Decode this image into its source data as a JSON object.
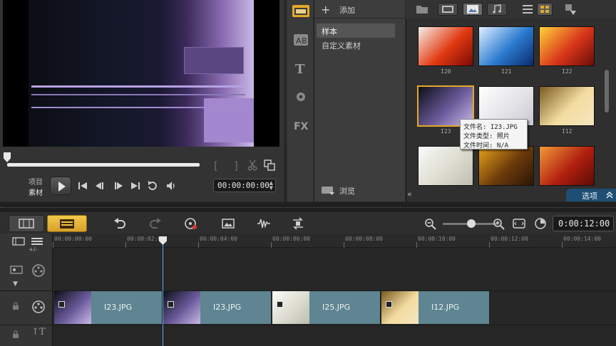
{
  "preview": {
    "mode_project": "项目",
    "mode_clip": "素材",
    "mark_in": "[",
    "mark_out": "]",
    "timecode": "00:00:00:00"
  },
  "library": {
    "add_label": "添加",
    "folders": [
      {
        "label": "样本",
        "selected": true
      },
      {
        "label": "自定义素材",
        "selected": false
      }
    ],
    "browse_label": "浏览",
    "options_label": "选项",
    "thumbnails": [
      {
        "label": "I20",
        "colors": [
          "#f5f0e8",
          "#e23a12",
          "#7a0a06"
        ]
      },
      {
        "label": "I21",
        "colors": [
          "#dfefff",
          "#2a7ad0",
          "#0a2a6a"
        ]
      },
      {
        "label": "I22",
        "colors": [
          "#ffd23a",
          "#d9361a",
          "#6a0c08"
        ]
      },
      {
        "label": "I23",
        "colors": [
          "#0d0f18",
          "#6a5a9a",
          "#c9b8e6"
        ],
        "selected": true
      },
      {
        "label": "",
        "colors": [
          "#ffffff",
          "#e4e4e8",
          "#c8c8d0"
        ]
      },
      {
        "label": "I12",
        "colors": [
          "#7a5a20",
          "#f3dca0",
          "#f5e6c0"
        ]
      },
      {
        "label": "",
        "colors": [
          "#fafafa",
          "#dcdcd0",
          "#bdbdb0"
        ]
      },
      {
        "label": "",
        "colors": [
          "#e8a21a",
          "#6a3a0a",
          "#2a1605"
        ]
      },
      {
        "label": "",
        "colors": [
          "#f09a3a",
          "#b2200e",
          "#5a0c06"
        ]
      }
    ],
    "tooltip": {
      "line1": "文件名: I23.JPG",
      "line2": "文件类型: 照片",
      "line3": "文件时间: N/A"
    }
  },
  "timeline": {
    "duration": "0:00:12:00",
    "ruler_ticks": [
      "00:00:00:00",
      "00:00:02:00",
      "00:00:04:00",
      "00:00:06:00",
      "00:00:08:00",
      "00:00:10:00",
      "00:00:12:00",
      "00:00:14:00"
    ],
    "track_add_label": "+/-",
    "clips": [
      {
        "label": "I23.JPG",
        "thumb": [
          "#0d0f18",
          "#6a5a9a",
          "#c9b8e6"
        ]
      },
      {
        "label": "I23.JPG",
        "thumb": [
          "#0d0f18",
          "#6a5a9a",
          "#c9b8e6"
        ]
      },
      {
        "label": "I25.JPG",
        "thumb": [
          "#fafafa",
          "#dcdcd0",
          "#bdbdb0"
        ]
      },
      {
        "label": "I12.JPG",
        "thumb": [
          "#7a5a20",
          "#f3dca0",
          "#f5e6c0"
        ]
      }
    ],
    "title_track_label": "T"
  },
  "colors": {
    "accent_yellow": "#f2c84a",
    "options_blue": "#1e4e73",
    "clip_teal": "#5e8591",
    "playhead": "#57a9e6"
  }
}
